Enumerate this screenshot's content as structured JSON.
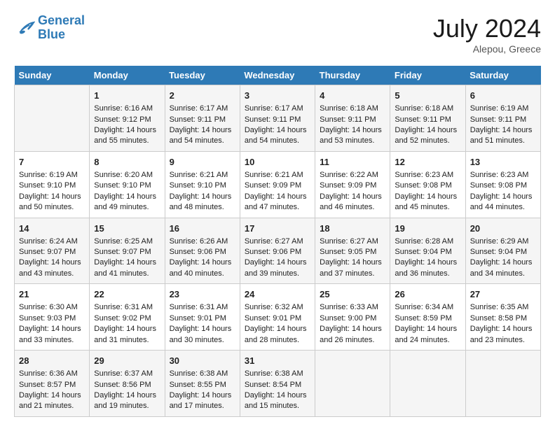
{
  "logo": {
    "line1": "General",
    "line2": "Blue"
  },
  "title": "July 2024",
  "location": "Alepou, Greece",
  "days_of_week": [
    "Sunday",
    "Monday",
    "Tuesday",
    "Wednesday",
    "Thursday",
    "Friday",
    "Saturday"
  ],
  "weeks": [
    [
      {
        "day": "",
        "content": ""
      },
      {
        "day": "1",
        "content": "Sunrise: 6:16 AM\nSunset: 9:12 PM\nDaylight: 14 hours\nand 55 minutes."
      },
      {
        "day": "2",
        "content": "Sunrise: 6:17 AM\nSunset: 9:11 PM\nDaylight: 14 hours\nand 54 minutes."
      },
      {
        "day": "3",
        "content": "Sunrise: 6:17 AM\nSunset: 9:11 PM\nDaylight: 14 hours\nand 54 minutes."
      },
      {
        "day": "4",
        "content": "Sunrise: 6:18 AM\nSunset: 9:11 PM\nDaylight: 14 hours\nand 53 minutes."
      },
      {
        "day": "5",
        "content": "Sunrise: 6:18 AM\nSunset: 9:11 PM\nDaylight: 14 hours\nand 52 minutes."
      },
      {
        "day": "6",
        "content": "Sunrise: 6:19 AM\nSunset: 9:11 PM\nDaylight: 14 hours\nand 51 minutes."
      }
    ],
    [
      {
        "day": "7",
        "content": "Sunrise: 6:19 AM\nSunset: 9:10 PM\nDaylight: 14 hours\nand 50 minutes."
      },
      {
        "day": "8",
        "content": "Sunrise: 6:20 AM\nSunset: 9:10 PM\nDaylight: 14 hours\nand 49 minutes."
      },
      {
        "day": "9",
        "content": "Sunrise: 6:21 AM\nSunset: 9:10 PM\nDaylight: 14 hours\nand 48 minutes."
      },
      {
        "day": "10",
        "content": "Sunrise: 6:21 AM\nSunset: 9:09 PM\nDaylight: 14 hours\nand 47 minutes."
      },
      {
        "day": "11",
        "content": "Sunrise: 6:22 AM\nSunset: 9:09 PM\nDaylight: 14 hours\nand 46 minutes."
      },
      {
        "day": "12",
        "content": "Sunrise: 6:23 AM\nSunset: 9:08 PM\nDaylight: 14 hours\nand 45 minutes."
      },
      {
        "day": "13",
        "content": "Sunrise: 6:23 AM\nSunset: 9:08 PM\nDaylight: 14 hours\nand 44 minutes."
      }
    ],
    [
      {
        "day": "14",
        "content": "Sunrise: 6:24 AM\nSunset: 9:07 PM\nDaylight: 14 hours\nand 43 minutes."
      },
      {
        "day": "15",
        "content": "Sunrise: 6:25 AM\nSunset: 9:07 PM\nDaylight: 14 hours\nand 41 minutes."
      },
      {
        "day": "16",
        "content": "Sunrise: 6:26 AM\nSunset: 9:06 PM\nDaylight: 14 hours\nand 40 minutes."
      },
      {
        "day": "17",
        "content": "Sunrise: 6:27 AM\nSunset: 9:06 PM\nDaylight: 14 hours\nand 39 minutes."
      },
      {
        "day": "18",
        "content": "Sunrise: 6:27 AM\nSunset: 9:05 PM\nDaylight: 14 hours\nand 37 minutes."
      },
      {
        "day": "19",
        "content": "Sunrise: 6:28 AM\nSunset: 9:04 PM\nDaylight: 14 hours\nand 36 minutes."
      },
      {
        "day": "20",
        "content": "Sunrise: 6:29 AM\nSunset: 9:04 PM\nDaylight: 14 hours\nand 34 minutes."
      }
    ],
    [
      {
        "day": "21",
        "content": "Sunrise: 6:30 AM\nSunset: 9:03 PM\nDaylight: 14 hours\nand 33 minutes."
      },
      {
        "day": "22",
        "content": "Sunrise: 6:31 AM\nSunset: 9:02 PM\nDaylight: 14 hours\nand 31 minutes."
      },
      {
        "day": "23",
        "content": "Sunrise: 6:31 AM\nSunset: 9:01 PM\nDaylight: 14 hours\nand 30 minutes."
      },
      {
        "day": "24",
        "content": "Sunrise: 6:32 AM\nSunset: 9:01 PM\nDaylight: 14 hours\nand 28 minutes."
      },
      {
        "day": "25",
        "content": "Sunrise: 6:33 AM\nSunset: 9:00 PM\nDaylight: 14 hours\nand 26 minutes."
      },
      {
        "day": "26",
        "content": "Sunrise: 6:34 AM\nSunset: 8:59 PM\nDaylight: 14 hours\nand 24 minutes."
      },
      {
        "day": "27",
        "content": "Sunrise: 6:35 AM\nSunset: 8:58 PM\nDaylight: 14 hours\nand 23 minutes."
      }
    ],
    [
      {
        "day": "28",
        "content": "Sunrise: 6:36 AM\nSunset: 8:57 PM\nDaylight: 14 hours\nand 21 minutes."
      },
      {
        "day": "29",
        "content": "Sunrise: 6:37 AM\nSunset: 8:56 PM\nDaylight: 14 hours\nand 19 minutes."
      },
      {
        "day": "30",
        "content": "Sunrise: 6:38 AM\nSunset: 8:55 PM\nDaylight: 14 hours\nand 17 minutes."
      },
      {
        "day": "31",
        "content": "Sunrise: 6:38 AM\nSunset: 8:54 PM\nDaylight: 14 hours\nand 15 minutes."
      },
      {
        "day": "",
        "content": ""
      },
      {
        "day": "",
        "content": ""
      },
      {
        "day": "",
        "content": ""
      }
    ]
  ]
}
